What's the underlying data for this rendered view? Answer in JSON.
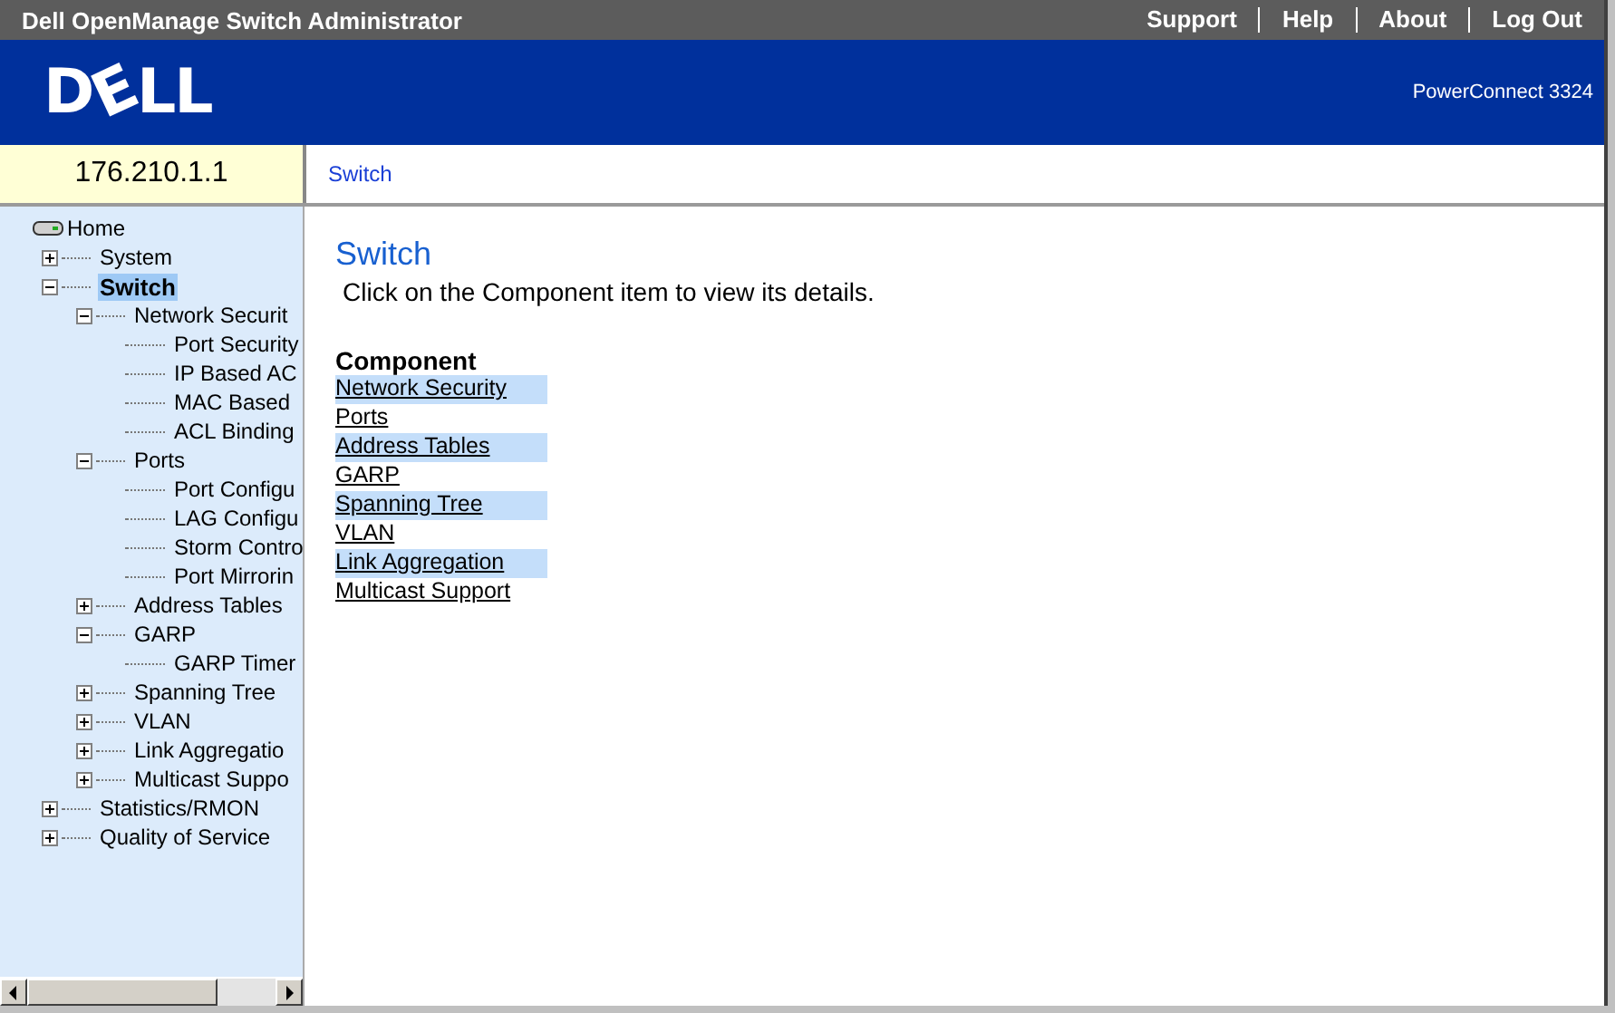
{
  "title_bar": {
    "title": "Dell OpenManage Switch Administrator",
    "links": [
      "Support",
      "Help",
      "About",
      "Log Out"
    ]
  },
  "header": {
    "logo": "DELL",
    "product": "PowerConnect 3324"
  },
  "address_bar": {
    "ip": "176.210.1.1",
    "breadcrumb": "Switch"
  },
  "tree": [
    {
      "label": "Home",
      "kind": "root",
      "selected": false,
      "children": [
        {
          "label": "System",
          "kind": "folder",
          "expanded": false,
          "selected": false
        },
        {
          "label": "Switch",
          "kind": "folder",
          "expanded": true,
          "selected": true,
          "children": [
            {
              "label": "Network Securit",
              "kind": "folder",
              "expanded": true,
              "selected": false,
              "children": [
                {
                  "label": "Port Security",
                  "kind": "leaf",
                  "selected": false
                },
                {
                  "label": "IP Based AC",
                  "kind": "leaf",
                  "selected": false
                },
                {
                  "label": "MAC Based",
                  "kind": "leaf",
                  "selected": false
                },
                {
                  "label": "ACL Binding",
                  "kind": "leaf",
                  "selected": false
                }
              ]
            },
            {
              "label": "Ports",
              "kind": "folder",
              "expanded": true,
              "selected": false,
              "children": [
                {
                  "label": "Port Configu",
                  "kind": "leaf",
                  "selected": false
                },
                {
                  "label": "LAG Configu",
                  "kind": "leaf",
                  "selected": false
                },
                {
                  "label": "Storm Contro",
                  "kind": "leaf",
                  "selected": false
                },
                {
                  "label": "Port Mirrorin",
                  "kind": "leaf",
                  "selected": false
                }
              ]
            },
            {
              "label": "Address Tables",
              "kind": "folder",
              "expanded": false,
              "selected": false
            },
            {
              "label": "GARP",
              "kind": "folder",
              "expanded": true,
              "selected": false,
              "children": [
                {
                  "label": "GARP Timer",
                  "kind": "leaf",
                  "selected": false
                }
              ]
            },
            {
              "label": "Spanning Tree",
              "kind": "folder",
              "expanded": false,
              "selected": false
            },
            {
              "label": "VLAN",
              "kind": "folder",
              "expanded": false,
              "selected": false
            },
            {
              "label": "Link Aggregatio",
              "kind": "folder",
              "expanded": false,
              "selected": false
            },
            {
              "label": "Multicast Suppo",
              "kind": "folder",
              "expanded": false,
              "selected": false
            }
          ]
        },
        {
          "label": "Statistics/RMON",
          "kind": "folder",
          "expanded": false,
          "selected": false
        },
        {
          "label": "Quality of Service",
          "kind": "folder",
          "expanded": false,
          "selected": false
        }
      ]
    }
  ],
  "content": {
    "title": "Switch",
    "intro": "Click on the Component item to view its details.",
    "list_heading": "Component",
    "components": [
      "Network Security",
      "Ports",
      "Address Tables",
      "GARP",
      "Spanning Tree",
      "VLAN",
      "Link Aggregation",
      "Multicast Support"
    ]
  }
}
